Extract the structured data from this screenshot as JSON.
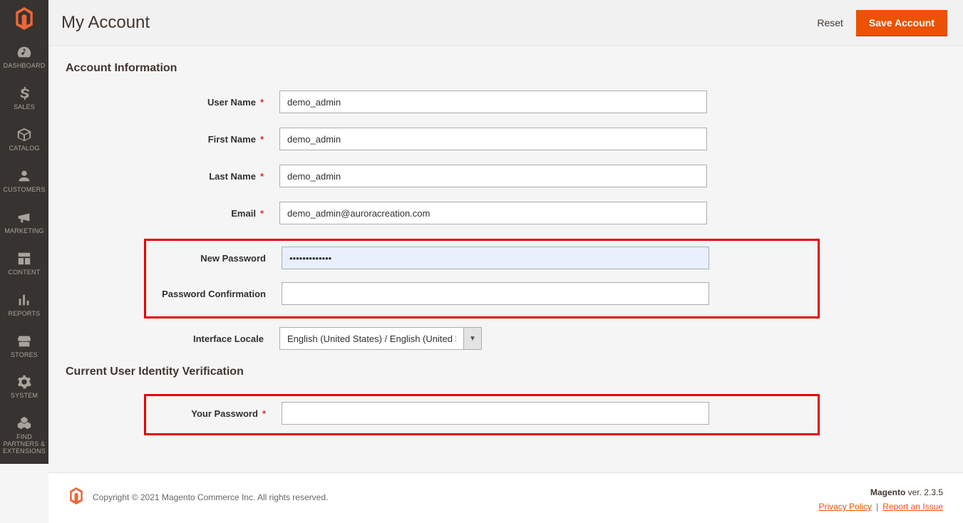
{
  "sidebar": {
    "items": [
      {
        "label": "DASHBOARD"
      },
      {
        "label": "SALES"
      },
      {
        "label": "CATALOG"
      },
      {
        "label": "CUSTOMERS"
      },
      {
        "label": "MARKETING"
      },
      {
        "label": "CONTENT"
      },
      {
        "label": "REPORTS"
      },
      {
        "label": "STORES"
      },
      {
        "label": "SYSTEM"
      },
      {
        "label": "FIND PARTNERS & EXTENSIONS"
      }
    ]
  },
  "header": {
    "title": "My Account",
    "actions": {
      "reset": "Reset",
      "save": "Save Account"
    }
  },
  "sections": {
    "account_info_title": "Account Information",
    "identity_title": "Current User Identity Verification"
  },
  "fields": {
    "username": {
      "label": "User Name",
      "value": "demo_admin"
    },
    "firstname": {
      "label": "First Name",
      "value": "demo_admin"
    },
    "lastname": {
      "label": "Last Name",
      "value": "demo_admin"
    },
    "email": {
      "label": "Email",
      "value": "demo_admin@auroracreation.com"
    },
    "new_password": {
      "label": "New Password",
      "value": "•••••••••••••"
    },
    "password_confirmation": {
      "label": "Password Confirmation",
      "value": ""
    },
    "locale": {
      "label": "Interface Locale",
      "value": "English (United States) / English (United States)"
    },
    "your_password": {
      "label": "Your Password",
      "value": ""
    }
  },
  "footer": {
    "copyright": "Copyright © 2021 Magento Commerce Inc. All rights reserved.",
    "version_label": "Magento",
    "version_suffix": " ver. 2.3.5",
    "privacy": "Privacy Policy",
    "report": "Report an Issue"
  }
}
